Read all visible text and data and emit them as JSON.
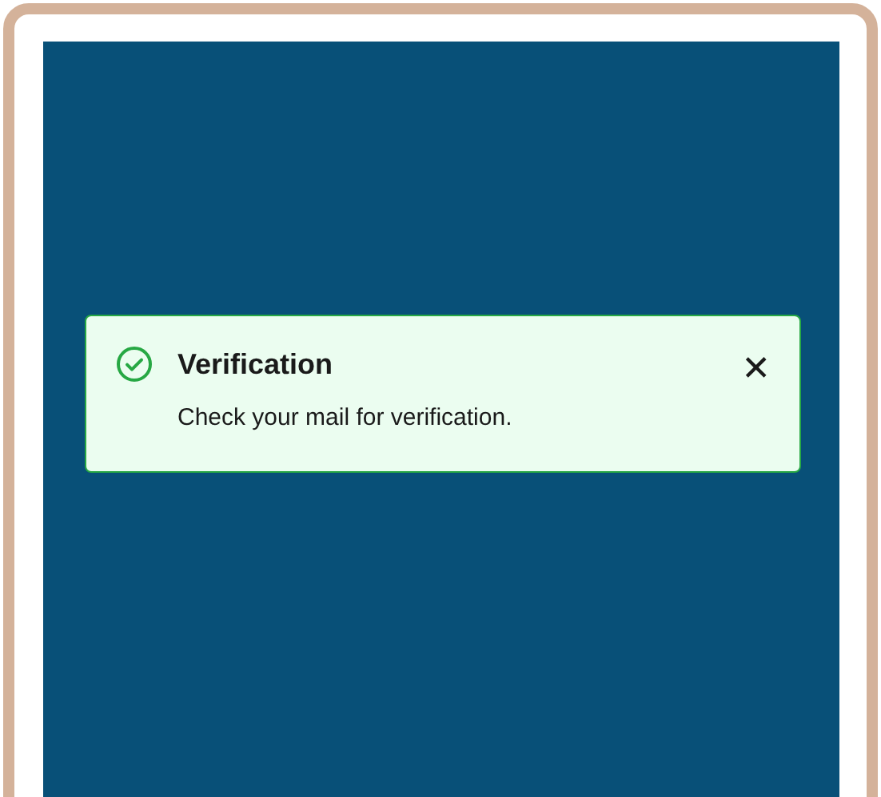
{
  "notification": {
    "kind": "success",
    "title": "Verification",
    "message": "Check your mail for verification.",
    "close": "✕"
  }
}
